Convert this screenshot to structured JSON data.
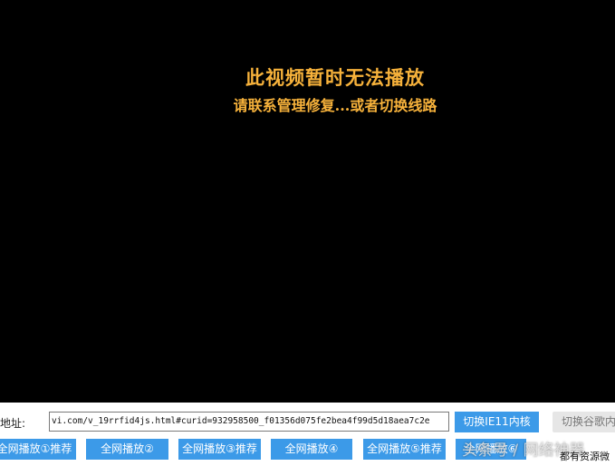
{
  "video": {
    "error_title": "此视频暂时无法播放",
    "error_subtitle": "请联系管理修复...或者切换线路"
  },
  "address_bar": {
    "label": "放地址:",
    "value": "vi.com/v_19rrfid4js.html#curid=932958500_f01356d075fe2bea4f99d5d18aea7c2e"
  },
  "buttons": {
    "switch_ie11": "切换IE11内核",
    "switch_chrome": "切换谷歌内",
    "play_lines": [
      "全网播放①推荐",
      "全网播放②",
      "全网播放③推荐",
      "全网播放④",
      "全网播放⑤推荐",
      "全网播放⑥"
    ]
  },
  "watermark": "头条号 / 网络神器",
  "corner_text": "都有资源微"
}
